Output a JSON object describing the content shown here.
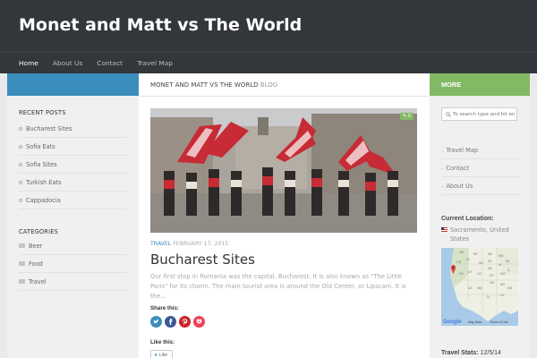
{
  "site": {
    "title": "Monet and Matt vs The World"
  },
  "nav": [
    {
      "label": "Home"
    },
    {
      "label": "About Us"
    },
    {
      "label": "Contact"
    },
    {
      "label": "Travel Map"
    }
  ],
  "left": {
    "recent_title": "Recent Posts",
    "recent_posts": [
      "Bucharest Sites",
      "Sofia Eats",
      "Sofia Sites",
      "Turkish Eats",
      "Cappadocia"
    ],
    "categories_title": "Categories",
    "categories": [
      "Beer",
      "Food",
      "Travel"
    ]
  },
  "main": {
    "heading": "Monet and Matt vs The World",
    "heading_suffix": "Blog",
    "comment_count": "0",
    "post": {
      "category": "Travel",
      "date": "February 17, 2015",
      "title": "Bucharest Sites",
      "excerpt": "Our first stop in Romania was the capital, Bucharest. It is also known as \"The Little Paris\" for its charm. The main tourist area is around the Old Center, or Lipscani. It is the…"
    },
    "share_label": "Share this:",
    "share_buttons": [
      "twitter",
      "facebook",
      "pinterest",
      "pocket"
    ],
    "like_label": "Like this:",
    "like_button": "Like"
  },
  "right": {
    "more_label": "More",
    "search_placeholder": "To search type and hit en",
    "links": [
      "Travel Map",
      "Contact",
      "About Us"
    ],
    "location_title": "Current Location:",
    "location": "Sacramento, United States",
    "map_labels": {
      "google": "Google",
      "map_data": "Map Data",
      "terms": "Terms of Use",
      "states": [
        "WA",
        "MT",
        "OR",
        "ID",
        "NV",
        "UT",
        "CO",
        "AZ",
        "NM",
        "WY",
        "ND",
        "SD",
        "NE",
        "KS",
        "OK",
        "TX",
        "MN",
        "IA",
        "MO",
        "AR",
        "LA",
        "WI",
        "IL",
        "MS"
      ]
    },
    "stats_label": "Travel Stats:",
    "stats_value": "12/5/14"
  },
  "colors": {
    "header": "#33363b",
    "blue": "#3b8dbd",
    "green": "#82b965"
  }
}
